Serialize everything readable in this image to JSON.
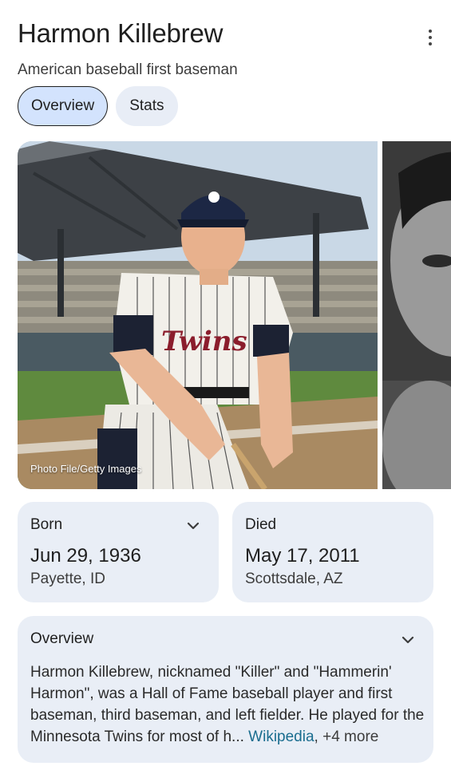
{
  "entity": {
    "name": "Harmon Killebrew",
    "description": "American baseball first baseman"
  },
  "tabs": [
    {
      "label": "Overview",
      "active": true
    },
    {
      "label": "Stats",
      "active": false
    }
  ],
  "gallery": {
    "credit": "Photo File/Getty Images"
  },
  "born": {
    "label": "Born",
    "date": "Jun 29, 1936",
    "place": "Payette, ID"
  },
  "died": {
    "label": "Died",
    "date": "May 17, 2011",
    "place": "Scottsdale, AZ"
  },
  "overview": {
    "label": "Overview",
    "text": "Harmon Killebrew, nicknamed \"Killer\" and \"Hammerin' Harmon\", was a Hall of Fame baseball player and first baseman, third baseman, and left fielder. He played for the Minnesota Twins for most of h",
    "ellipsis": "...",
    "source": "Wikipedia",
    "more": ", +4 more"
  },
  "icons": {
    "menu": "more-vert-icon",
    "expand": "chevron-down-icon"
  },
  "colors": {
    "chip_active_bg": "#d3e3fd",
    "card_bg": "#e9eef6",
    "link": "#1a6d8f"
  }
}
